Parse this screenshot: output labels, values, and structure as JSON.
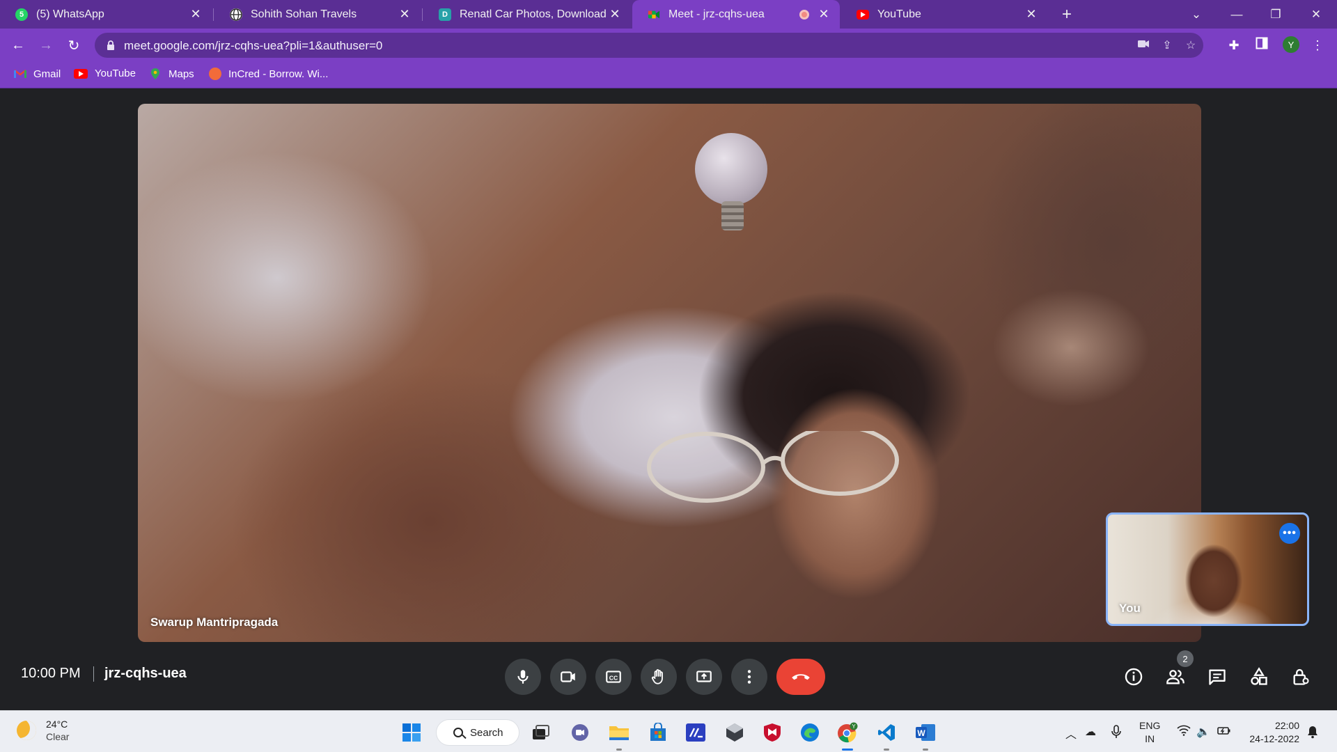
{
  "browser": {
    "tabs": [
      {
        "title": "(5) WhatsApp",
        "icon": "whatsapp-icon",
        "badge": "5",
        "color": "#25d366",
        "active": false
      },
      {
        "title": "Sohith Sohan Travels",
        "icon": "globe-icon",
        "color": "#ffffff",
        "active": false
      },
      {
        "title": "Renatl Car Photos, Download Fre",
        "icon": "freepik-icon",
        "badge": "D",
        "color": "#27a1a8",
        "active": false
      },
      {
        "title": "Meet - jrz-cqhs-uea",
        "icon": "google-meet-icon",
        "color": "#00ac47",
        "active": true
      },
      {
        "title": "YouTube",
        "icon": "youtube-icon",
        "color": "#ff0000",
        "active": false
      }
    ],
    "url": "meet.google.com/jrz-cqhs-uea?pli=1&authuser=0",
    "profile_initial": "Y",
    "bookmarks": [
      {
        "label": "Gmail",
        "icon": "gmail-icon",
        "color": "#ea4335"
      },
      {
        "label": "YouTube",
        "icon": "youtube-icon",
        "color": "#ff0000"
      },
      {
        "label": "Maps",
        "icon": "maps-icon",
        "color": "#34a853"
      },
      {
        "label": "InCred - Borrow. Wi...",
        "icon": "incred-icon",
        "color": "#f26b3a"
      }
    ],
    "theme_colors": {
      "tab_strip": "#5a2e94",
      "toolbar": "#7b3fc4"
    }
  },
  "meet": {
    "main_participant": "Swarup Mantripragada",
    "self_label": "You",
    "time": "10:00 PM",
    "meeting_code": "jrz-cqhs-uea",
    "participant_count": "2",
    "controls": [
      "microphone",
      "camera",
      "captions",
      "raise-hand",
      "present-screen",
      "more-options",
      "leave-call"
    ],
    "side_controls": [
      "meeting-details",
      "people",
      "chat",
      "activities",
      "host-controls"
    ],
    "leave_color": "#ea4335"
  },
  "taskbar": {
    "weather": {
      "temp": "24°C",
      "condition": "Clear"
    },
    "search_label": "Search",
    "apps": [
      "start-icon",
      "search",
      "task-view-icon",
      "teams-chat-icon",
      "file-explorer-icon",
      "microsoft-store-icon",
      "code-app-icon",
      "unity-icon",
      "mcafee-icon",
      "edge-icon",
      "chrome-icon",
      "vscode-icon",
      "word-icon"
    ],
    "chrome_profile_initial": "Y",
    "language": {
      "line1": "ENG",
      "line2": "IN"
    },
    "time": "22:00",
    "date": "24-12-2022"
  }
}
